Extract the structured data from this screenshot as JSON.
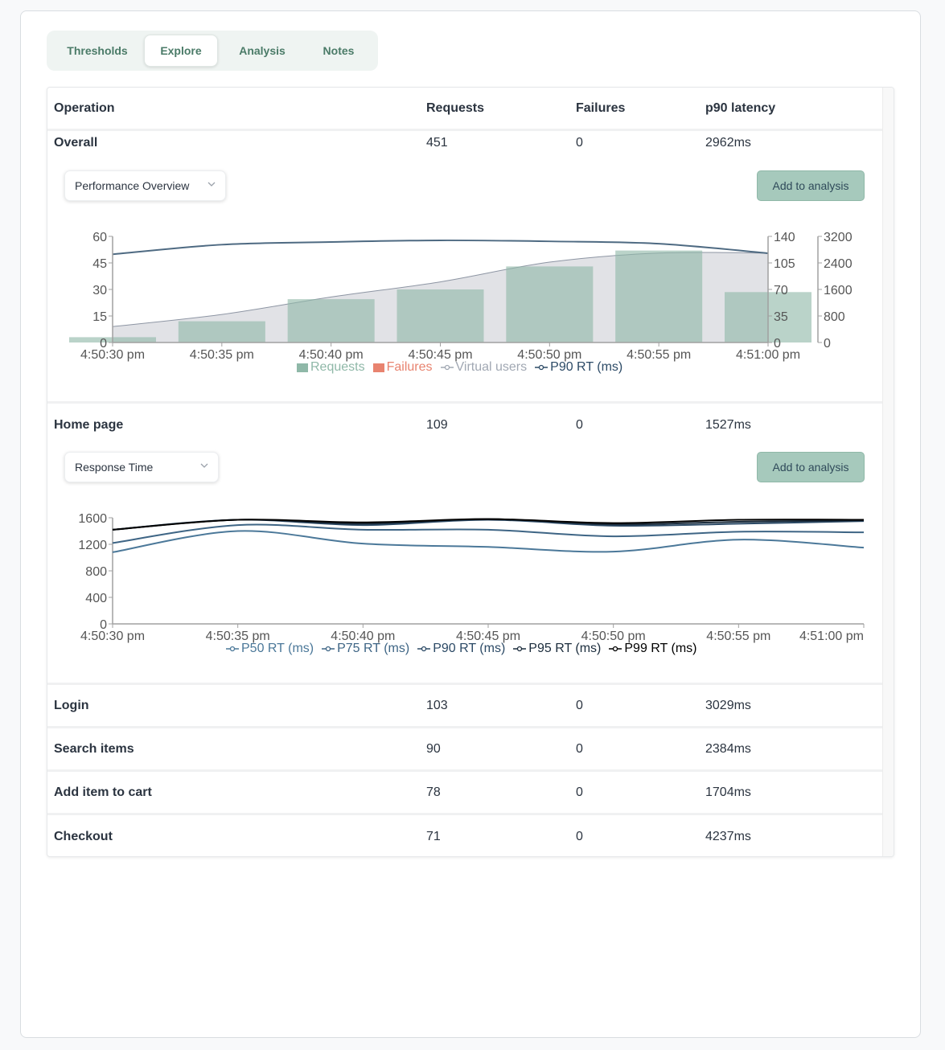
{
  "tabs": [
    {
      "label": "Thresholds",
      "active": false
    },
    {
      "label": "Explore",
      "active": true
    },
    {
      "label": "Analysis",
      "active": false
    },
    {
      "label": "Notes",
      "active": false
    }
  ],
  "table": {
    "columns": [
      "Operation",
      "Requests",
      "Failures",
      "p90 latency"
    ],
    "rows": [
      {
        "operation": "Overall",
        "requests": "451",
        "failures": "0",
        "p90": "2962ms"
      },
      {
        "operation": "Home page",
        "requests": "109",
        "failures": "0",
        "p90": "1527ms"
      },
      {
        "operation": "Login",
        "requests": "103",
        "failures": "0",
        "p90": "3029ms"
      },
      {
        "operation": "Search items",
        "requests": "90",
        "failures": "0",
        "p90": "2384ms"
      },
      {
        "operation": "Add item to cart",
        "requests": "78",
        "failures": "0",
        "p90": "1704ms"
      },
      {
        "operation": "Checkout",
        "requests": "71",
        "failures": "0",
        "p90": "4237ms"
      }
    ]
  },
  "panels": {
    "overall": {
      "select_value": "Performance Overview",
      "add_label": "Add to analysis"
    },
    "home": {
      "select_value": "Response Time",
      "add_label": "Add to analysis"
    }
  },
  "colors": {
    "requests": "#8fb8a8",
    "failures": "#e8836f",
    "virtual_users": "#a1a8b3",
    "p90": "#2c4a66",
    "p50": "#4b7899",
    "p75": "#3e6585",
    "p90_rt": "#2c4a66",
    "p95": "#1b2c3c",
    "p99": "#000000",
    "vu_fill": "#e1e2e6",
    "accent": "#4b7b68"
  },
  "chart_data": [
    {
      "type": "bar",
      "title": "Performance Overview",
      "categories": [
        "4:50:30 pm",
        "4:50:35 pm",
        "4:50:40 pm",
        "4:50:45 pm",
        "4:50:50 pm",
        "4:50:55 pm",
        "4:51:00 pm"
      ],
      "axes": {
        "left": {
          "ticks": [
            "0",
            "15",
            "30",
            "45",
            "60"
          ],
          "range": [
            0,
            60
          ]
        },
        "right_vu": {
          "ticks": [
            "0",
            "35",
            "70",
            "105",
            "140"
          ],
          "range": [
            0,
            140
          ]
        },
        "right_rt": {
          "ticks": [
            "0",
            "800",
            "1600",
            "2400",
            "3200"
          ],
          "range": [
            0,
            3200
          ]
        }
      },
      "series": [
        {
          "name": "Requests",
          "type": "bar",
          "axis": "left",
          "values": [
            3,
            12,
            24.5,
            30,
            43,
            52,
            28.5
          ]
        },
        {
          "name": "Failures",
          "type": "bar",
          "axis": "left",
          "values": [
            0,
            0,
            0,
            0,
            0,
            0,
            0
          ]
        },
        {
          "name": "Virtual users",
          "type": "area",
          "axis": "right_vu",
          "values": [
            21,
            37,
            60,
            80,
            106,
            118,
            118
          ]
        },
        {
          "name": "P90 RT (ms)",
          "type": "line",
          "axis": "right_rt",
          "values": [
            2660,
            2950,
            3030,
            3080,
            3050,
            2980,
            2690
          ]
        }
      ],
      "legend": "bottom"
    },
    {
      "type": "line",
      "title": "Response Time",
      "categories": [
        "4:50:30 pm",
        "4:50:35 pm",
        "4:50:40 pm",
        "4:50:45 pm",
        "4:50:50 pm",
        "4:50:55 pm",
        "4:51:00 pm"
      ],
      "ylim": [
        0,
        1600
      ],
      "yticks": [
        "0",
        "400",
        "800",
        "1200",
        "1600"
      ],
      "series": [
        {
          "name": "P50 RT (ms)",
          "values": [
            1080,
            1400,
            1210,
            1160,
            1090,
            1270,
            1150
          ]
        },
        {
          "name": "P75 RT (ms)",
          "values": [
            1220,
            1490,
            1420,
            1420,
            1320,
            1390,
            1380
          ]
        },
        {
          "name": "P90 RT (ms)",
          "values": [
            1420,
            1570,
            1490,
            1570,
            1480,
            1510,
            1550
          ]
        },
        {
          "name": "P95 RT (ms)",
          "values": [
            1420,
            1570,
            1510,
            1580,
            1500,
            1540,
            1560
          ]
        },
        {
          "name": "P99 RT (ms)",
          "values": [
            1420,
            1570,
            1530,
            1580,
            1520,
            1570,
            1570
          ]
        }
      ],
      "legend": "bottom"
    }
  ]
}
